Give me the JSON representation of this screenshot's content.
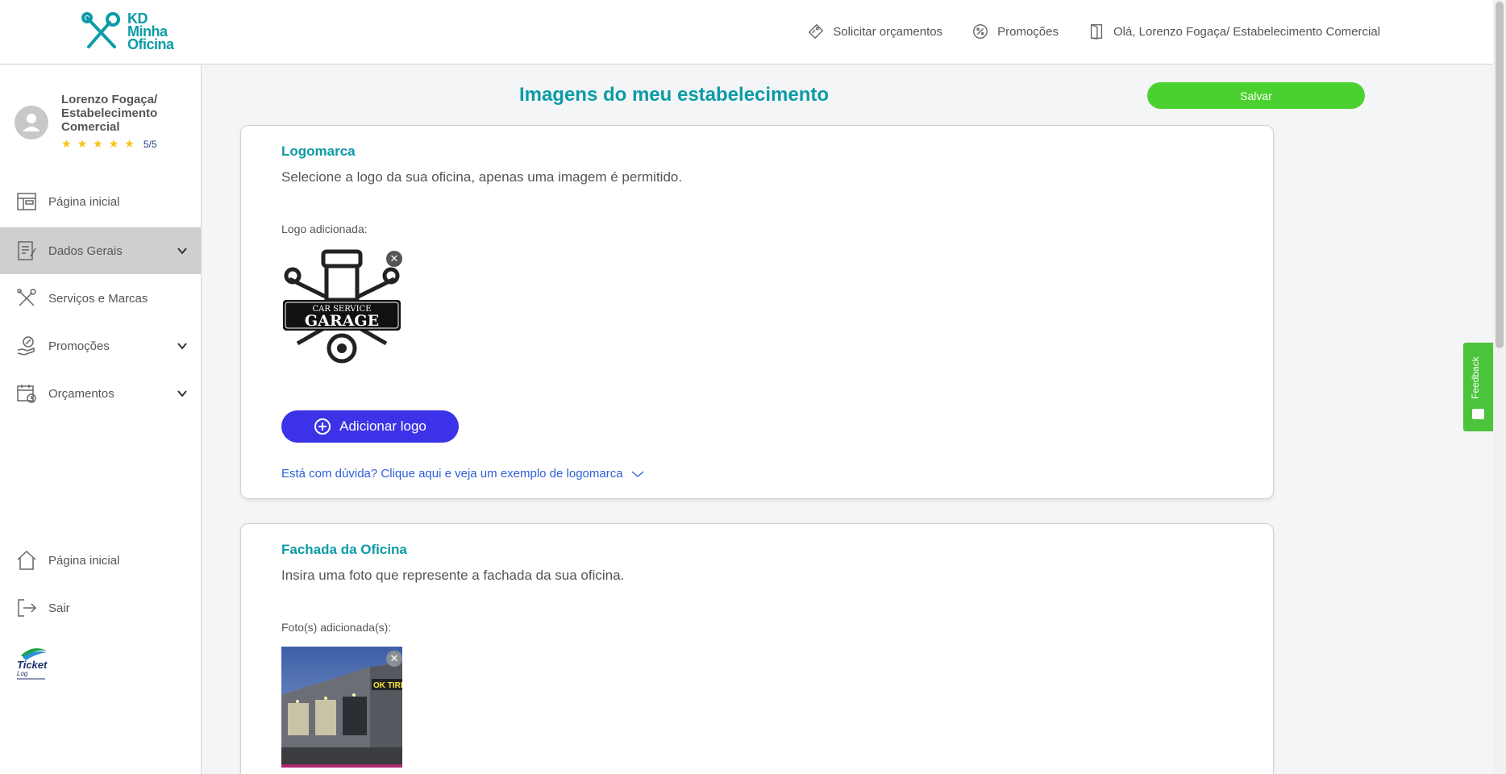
{
  "brand": {
    "logo_text": "KD Minha Oficina",
    "line1": "KD",
    "line2": "Minha",
    "line3": "Oficina"
  },
  "topnav": {
    "quotes": "Solicitar orçamentos",
    "promotions": "Promoções",
    "greeting": "Olá, Lorenzo Fogaça/ Estabelecimento Comercial"
  },
  "sidebar": {
    "profile_name": "Lorenzo Fogaça/ Estabelecimento Comercial",
    "rating": "5/5",
    "stars": 5,
    "items": [
      {
        "label": "Página inicial",
        "icon": "layout-icon"
      },
      {
        "label": "Dados Gerais",
        "icon": "document-icon",
        "active": true
      },
      {
        "label": "Serviços e Marcas",
        "icon": "tools-icon"
      },
      {
        "label": "Promoções",
        "icon": "discount-hand-icon"
      },
      {
        "label": "Orçamentos",
        "icon": "calendar-icon"
      }
    ],
    "bottom_items": [
      {
        "label": "Página inicial",
        "icon": "home-icon"
      },
      {
        "label": "Sair",
        "icon": "logout-icon"
      }
    ],
    "partner_logo_text": "Ticket Log"
  },
  "main": {
    "title": "Imagens do meu estabelecimento",
    "save_label": "Salvar",
    "logo_card": {
      "title": "Logomarca",
      "description": "Selecione a logo da sua oficina, apenas uma imagem é permitido.",
      "added_label": "Logo adicionada:",
      "image_line1": "CAR SERVICE",
      "image_line2": "GARAGE",
      "add_button": "Adicionar logo",
      "help_link": "Está com dúvida? Clique aqui e veja um exemplo de logomarca"
    },
    "facade_card": {
      "title": "Fachada da Oficina",
      "description": "Insira uma foto que represente a fachada da sua oficina.",
      "added_label": "Foto(s) adicionada(s):",
      "sign_text": "OK TIRE"
    }
  },
  "feedback": {
    "label": "Feedback"
  },
  "colors": {
    "accent": "#0d9ba6",
    "save": "#4bd12f",
    "add": "#3c33e8",
    "link": "#2f5fd8",
    "feedback": "#4bc33a"
  }
}
